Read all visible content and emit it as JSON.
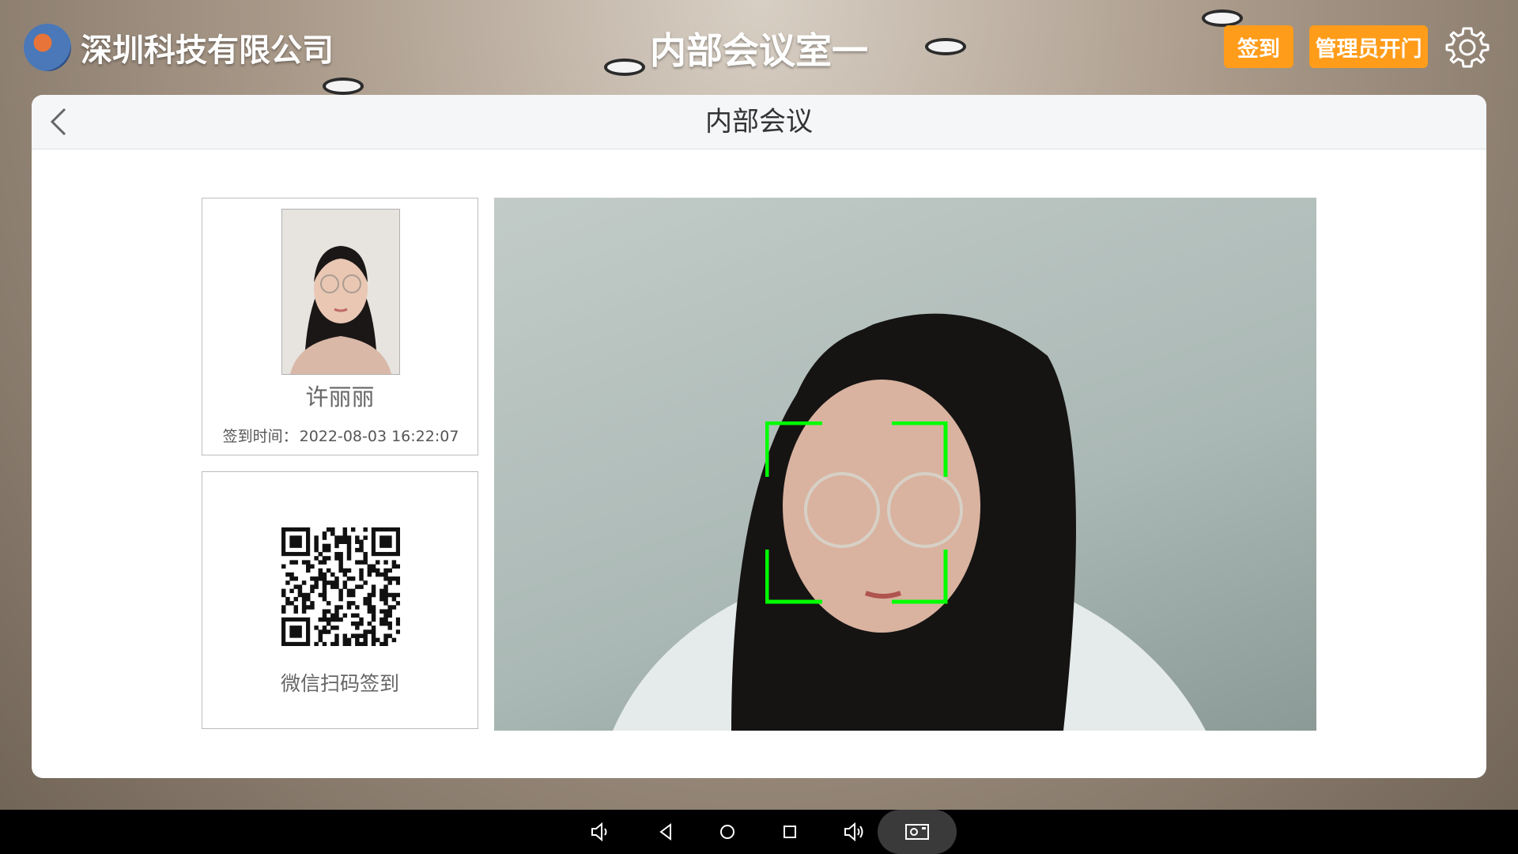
{
  "header": {
    "company_name": "深圳科技有限公司",
    "room_title": "内部会议室一",
    "sign_in_button": "签到",
    "admin_open_button": "管理员开门",
    "accent_color": "#ff9c1a"
  },
  "panel": {
    "title": "内部会议"
  },
  "person": {
    "name": "许丽丽",
    "sign_time_label": "签到时间：",
    "sign_time_value": "2022-08-03 16:22:07"
  },
  "qr": {
    "label": "微信扫码签到"
  },
  "camera": {
    "face_frame_color": "#00ff00"
  },
  "icons": {
    "back": "chevron-left-icon",
    "settings": "gear-icon",
    "volume_down": "volume-down-icon",
    "nav_back": "triangle-back-icon",
    "nav_home": "circle-home-icon",
    "nav_recents": "square-recents-icon",
    "volume_up": "volume-up-icon",
    "screenshot": "screenshot-icon"
  }
}
